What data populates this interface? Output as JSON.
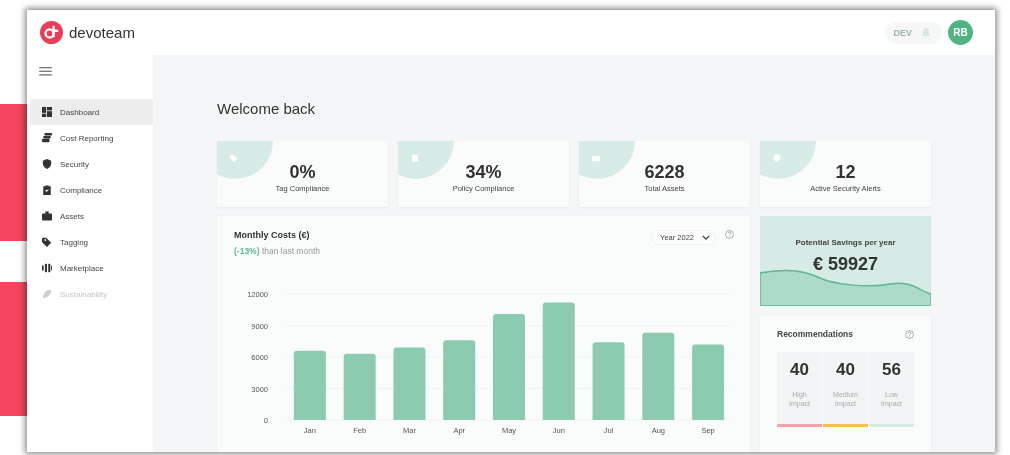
{
  "brand": {
    "name": "devoteam"
  },
  "header": {
    "environment": {
      "label": "DEV",
      "disabled": true
    },
    "avatar": "RB"
  },
  "sidebar": {
    "items": [
      {
        "label": "Dashboard",
        "selected": true,
        "disabled": false
      },
      {
        "label": "Cost Reporting",
        "selected": false,
        "disabled": false
      },
      {
        "label": "Security",
        "selected": false,
        "disabled": false
      },
      {
        "label": "Compliance",
        "selected": false,
        "disabled": false
      },
      {
        "label": "Assets",
        "selected": false,
        "disabled": false
      },
      {
        "label": "Tagging",
        "selected": false,
        "disabled": false
      },
      {
        "label": "Marketplace",
        "selected": false,
        "disabled": false
      },
      {
        "label": "Sustainability",
        "selected": false,
        "disabled": true
      }
    ]
  },
  "page": {
    "title": "Welcome back"
  },
  "stats": [
    {
      "value": "0%",
      "label": "Tag Compliance"
    },
    {
      "value": "34%",
      "label": "Policy Compliance"
    },
    {
      "value": "6228",
      "label": "Total Assets"
    },
    {
      "value": "12",
      "label": "Active Security Alerts"
    }
  ],
  "monthly_costs": {
    "title": "Monthly Costs (€)",
    "change_note": "**(-13%)** than last month",
    "period": "Year 2022",
    "chart_data": {
      "type": "bar",
      "categories": [
        "Jan",
        "Feb",
        "Mar",
        "Apr",
        "May",
        "Jun",
        "Jul",
        "Aug",
        "Sep"
      ],
      "grid": true,
      "series": [
        {
          "color": "#8ccbb0",
          "values": [
            6600,
            6300,
            6900,
            7600,
            10100,
            11200,
            7400,
            8300,
            7200
          ]
        }
      ],
      "ylim": [
        0,
        12000
      ],
      "yticks": [
        0,
        3000,
        6000,
        9000,
        12000
      ]
    }
  },
  "savings": {
    "title": "Potential Savings per year",
    "amount": "€ 59927"
  },
  "recommendations": {
    "title": "Recommendations",
    "items": [
      {
        "count": "40",
        "label": "High Impact",
        "color": "#f7a1ab"
      },
      {
        "count": "40",
        "label": "Medium Impact",
        "color": "#fbbd4e"
      },
      {
        "count": "56",
        "label": "Low Impact",
        "color": "#d5ebe4"
      }
    ]
  }
}
